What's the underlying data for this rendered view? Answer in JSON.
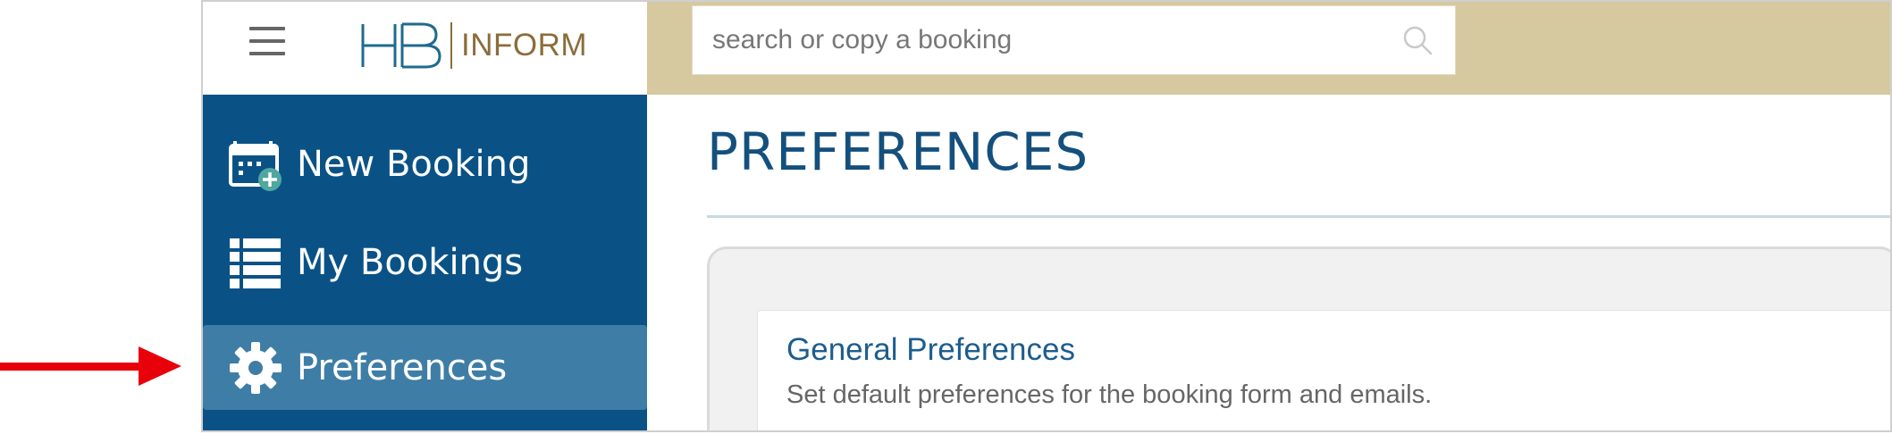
{
  "header": {
    "logo_mark": "HB",
    "logo_text": "INFORM",
    "menu_icon": "hamburger-icon",
    "search": {
      "placeholder": "search or copy a booking",
      "value": "",
      "icon": "search-icon"
    }
  },
  "sidebar": {
    "items": [
      {
        "label": "New Booking",
        "icon": "calendar-add-icon",
        "active": false
      },
      {
        "label": "My Bookings",
        "icon": "list-icon",
        "active": false
      },
      {
        "label": "Preferences",
        "icon": "gear-icon",
        "active": true
      }
    ]
  },
  "main": {
    "title": "PREFERENCES",
    "cards": [
      {
        "title": "General Preferences",
        "description": "Set default preferences for the booking form and emails."
      }
    ]
  },
  "colors": {
    "sidebar_bg": "#0a5286",
    "sidebar_active": "#3e7ea6",
    "header_bar": "#d6c89f",
    "title": "#14507e",
    "brand_gold": "#8a6d3b",
    "annotation_arrow": "#e8000b"
  }
}
